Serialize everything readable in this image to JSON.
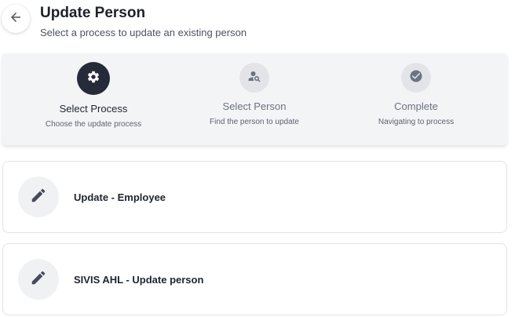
{
  "header": {
    "back_icon": "arrow-left-icon",
    "title": "Update Person",
    "subtitle": "Select a process to update an existing person"
  },
  "stepper": {
    "active_color": "#252b38",
    "inactive_color": "#e2e4e8",
    "steps": [
      {
        "icon": "gear-icon",
        "label": "Select Process",
        "description": "Choose the update process",
        "state": "active"
      },
      {
        "icon": "person-search-icon",
        "label": "Select Person",
        "description": "Find the person to update",
        "state": "inactive"
      },
      {
        "icon": "check-circle-icon",
        "label": "Complete",
        "description": "Navigating to process",
        "state": "inactive"
      }
    ]
  },
  "processes": [
    {
      "icon": "pencil-icon",
      "label": "Update - Employee"
    },
    {
      "icon": "pencil-icon",
      "label": "SIVIS AHL - Update person"
    }
  ]
}
